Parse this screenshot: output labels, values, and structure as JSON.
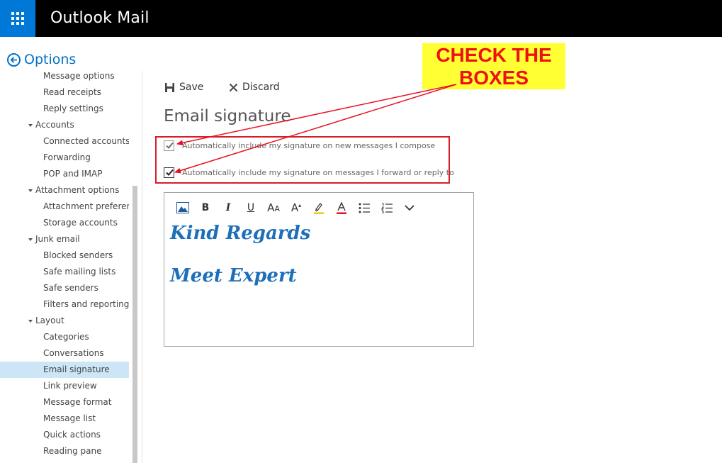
{
  "header": {
    "app_title": "Outlook Mail",
    "launcher_icon": "app-launcher-icon"
  },
  "sidebar": {
    "back_label": "Options",
    "items": [
      {
        "label": "Message options",
        "type": "child"
      },
      {
        "label": "Read receipts",
        "type": "child"
      },
      {
        "label": "Reply settings",
        "type": "child"
      },
      {
        "label": "Accounts",
        "type": "group"
      },
      {
        "label": "Connected accounts",
        "type": "child"
      },
      {
        "label": "Forwarding",
        "type": "child"
      },
      {
        "label": "POP and IMAP",
        "type": "child"
      },
      {
        "label": "Attachment options",
        "type": "group"
      },
      {
        "label": "Attachment preference",
        "type": "child"
      },
      {
        "label": "Storage accounts",
        "type": "child"
      },
      {
        "label": "Junk email",
        "type": "group"
      },
      {
        "label": "Blocked senders",
        "type": "child"
      },
      {
        "label": "Safe mailing lists",
        "type": "child"
      },
      {
        "label": "Safe senders",
        "type": "child"
      },
      {
        "label": "Filters and reporting",
        "type": "child"
      },
      {
        "label": "Layout",
        "type": "group"
      },
      {
        "label": "Categories",
        "type": "child"
      },
      {
        "label": "Conversations",
        "type": "child"
      },
      {
        "label": "Email signature",
        "type": "child",
        "selected": true
      },
      {
        "label": "Link preview",
        "type": "child"
      },
      {
        "label": "Message format",
        "type": "child"
      },
      {
        "label": "Message list",
        "type": "child"
      },
      {
        "label": "Quick actions",
        "type": "child"
      },
      {
        "label": "Reading pane",
        "type": "child"
      }
    ]
  },
  "commands": {
    "save_label": "Save",
    "discard_label": "Discard"
  },
  "main": {
    "title": "Email signature",
    "checkbox_new": {
      "label": "Automatically include my signature on new messages I compose",
      "checked": true
    },
    "checkbox_reply": {
      "label": "Automatically include my signature on messages I forward or reply to",
      "checked": true
    },
    "signature_lines": [
      "Kind Regards",
      "Meet Expert"
    ]
  },
  "callout": {
    "line1": "CHECK THE",
    "line2": "BOXES"
  },
  "colors": {
    "accent": "#0072c6",
    "brand": "#0078d7",
    "signature": "#1e6fb8",
    "callout_bg": "#ffff33",
    "callout_text": "#ee1111",
    "highlight_box": "#d71e28"
  }
}
